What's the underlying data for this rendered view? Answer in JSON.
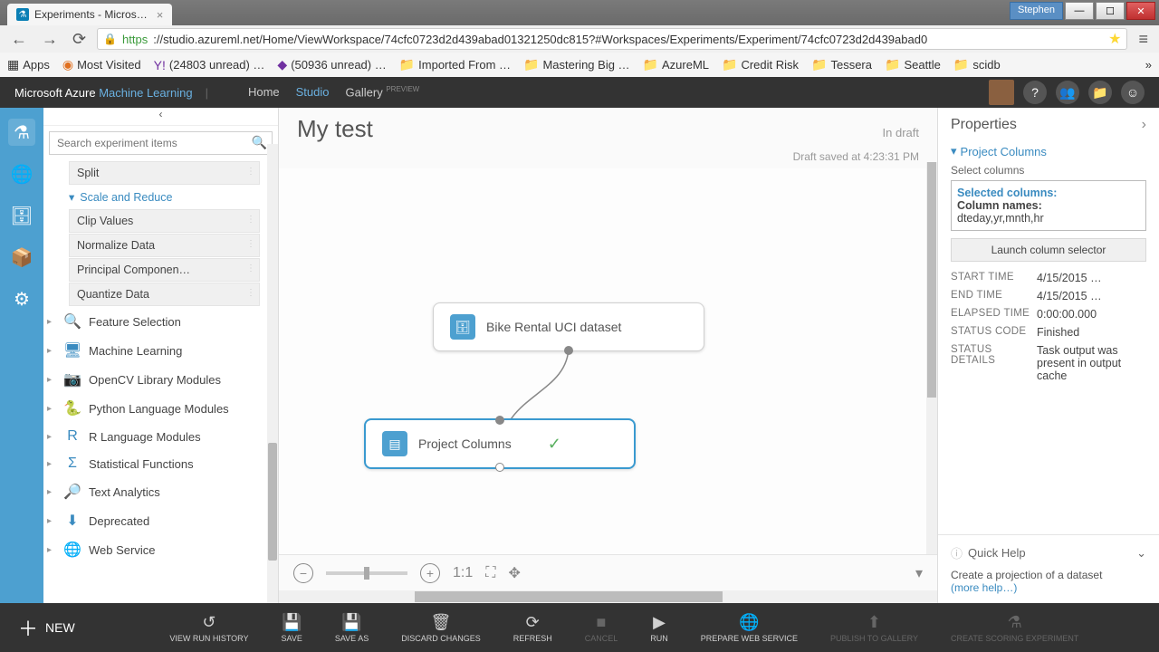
{
  "browser": {
    "tab_title": "Experiments - Micros…",
    "user": "Stephen",
    "url_https": "https",
    "url_rest": "://studio.azureml.net/Home/ViewWorkspace/74cfc0723d2d439abad01321250dc815?#Workspaces/Experiments/Experiment/74cfc0723d2d439abad0",
    "bookmarks": [
      "Apps",
      "Most Visited",
      "(24803 unread) …",
      "(50936 unread) …",
      "Imported From …",
      "Mastering Big …",
      "AzureML",
      "Credit Risk",
      "Tessera",
      "Seattle",
      "scidb"
    ]
  },
  "header": {
    "brand_a": "Microsoft Azure ",
    "brand_b": "Machine Learning",
    "nav": [
      "Home",
      "Studio",
      "Gallery"
    ],
    "preview": "PREVIEW"
  },
  "sidebar": {
    "search_placeholder": "Search experiment items",
    "leaf_split": "Split",
    "sub_scale": "Scale and Reduce",
    "leaves": [
      "Clip Values",
      "Normalize Data",
      "Principal Componen…",
      "Quantize Data"
    ],
    "cats": [
      "Feature Selection",
      "Machine Learning",
      "OpenCV Library Modules",
      "Python Language Modules",
      "R Language Modules",
      "Statistical Functions",
      "Text Analytics",
      "Deprecated",
      "Web Service"
    ]
  },
  "canvas": {
    "title": "My test",
    "status": "In draft",
    "saved": "Draft saved at 4:23:31 PM",
    "node_dataset": "Bike Rental UCI dataset",
    "node_project": "Project Columns"
  },
  "props": {
    "title": "Properties",
    "section": "Project Columns",
    "select_label": "Select columns",
    "selected_h": "Selected columns:",
    "selected_b": "Column names:",
    "selected_v": "dteday,yr,mnth,hr",
    "launch": "Launch column selector",
    "rows": [
      {
        "k": "START TIME",
        "v": "4/15/2015 …"
      },
      {
        "k": "END TIME",
        "v": "4/15/2015 …"
      },
      {
        "k": "ELAPSED TIME",
        "v": "0:00:00.000"
      },
      {
        "k": "STATUS CODE",
        "v": "Finished"
      },
      {
        "k": "STATUS DETAILS",
        "v": "Task output was present in output cache"
      }
    ],
    "qh_title": "Quick Help",
    "qh_body": "Create a projection of a dataset",
    "qh_link": "(more help…)"
  },
  "bottom": {
    "new": "NEW",
    "items": [
      "VIEW RUN HISTORY",
      "SAVE",
      "SAVE AS",
      "DISCARD CHANGES",
      "REFRESH",
      "CANCEL",
      "RUN",
      "PREPARE WEB SERVICE",
      "PUBLISH TO GALLERY",
      "CREATE SCORING EXPERIMENT"
    ]
  }
}
